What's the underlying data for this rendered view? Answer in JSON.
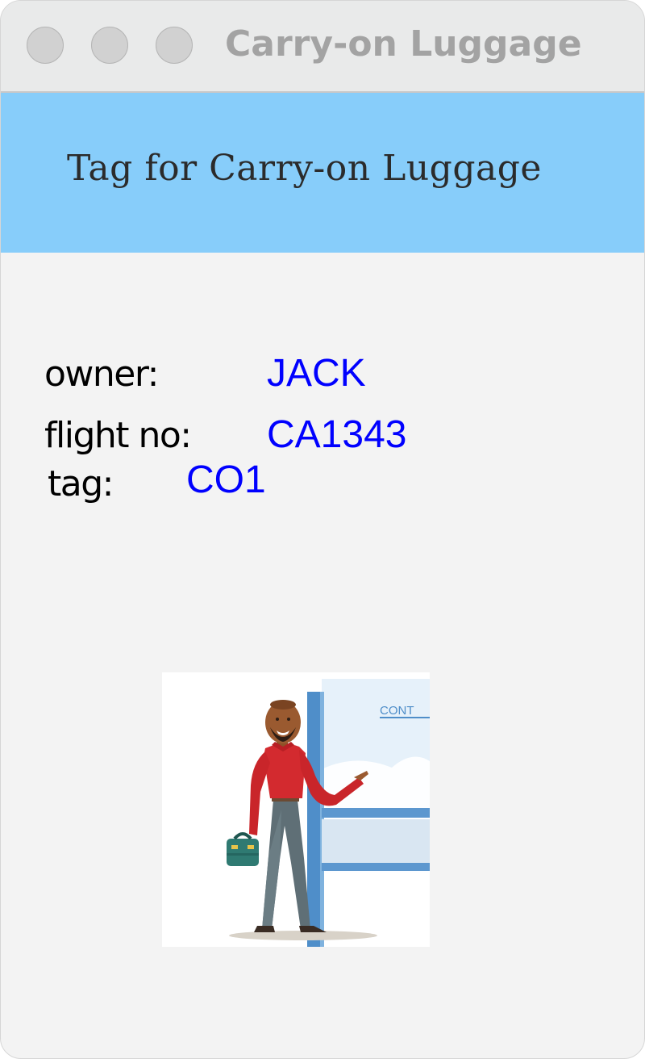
{
  "window": {
    "title": "Carry-on Luggage"
  },
  "header": {
    "title": "Tag for Carry-on Luggage"
  },
  "fields": {
    "owner_label": "owner:",
    "owner_value": "JACK",
    "flight_label": "flight no:",
    "flight_value": "CA1343",
    "tag_label": "tag:",
    "tag_value": "CO1"
  },
  "illustration": {
    "sign_text": "CONT"
  },
  "colors": {
    "header_bg": "#87cdfa",
    "value_text": "#0000ff",
    "window_bg": "#f3f3f3"
  }
}
